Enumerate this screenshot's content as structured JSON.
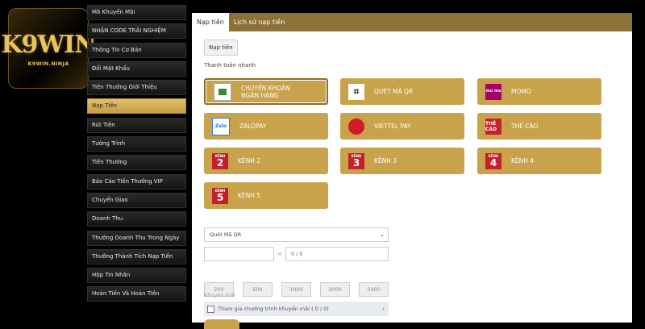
{
  "logo": {
    "main": "K9WIN",
    "sub": "K9WIN.NINJA"
  },
  "sidebar": {
    "items": [
      {
        "label": "Mã Khuyến Mãi"
      },
      {
        "label": "NHẬN CODE TRẢI NGHIỆM"
      },
      {
        "label": "Thông Tin Cơ Bản"
      },
      {
        "label": "Đổi Mật Khẩu"
      },
      {
        "label": "Tiền Thưởng Giới Thiệu"
      },
      {
        "label": "Nạp Tiền",
        "active": true
      },
      {
        "label": "Rút Tiền"
      },
      {
        "label": "Tường Trình"
      },
      {
        "label": "Tiền Thưởng"
      },
      {
        "label": "Báo Cáo Tiền Thưởng VIP"
      },
      {
        "label": "Chuyển Giao"
      },
      {
        "label": "Doanh Thu"
      },
      {
        "label": "Thưởng Doanh Thu Trong Ngày"
      },
      {
        "label": "Thưởng Thành Tích Nạp Tiền"
      },
      {
        "label": "Hộp Tin Nhắn"
      },
      {
        "label": "Hoàn Tiền Và Hoàn Tiền"
      }
    ]
  },
  "tabs": [
    {
      "label": "Nạp tiền",
      "active": true
    },
    {
      "label": "Lịch sử nạp tiền"
    }
  ],
  "top_button": "Nạp tiền",
  "section_label": "Thanh toán nhanh",
  "payment_methods": [
    {
      "line1": "CHUYỂN KHOẢN",
      "line2": "NGÂN HÀNG",
      "icon": "bank-transfer-icon",
      "selected": true
    },
    {
      "line1": "QUÉT MÃ QR",
      "line2": "",
      "icon": "qr-scan-icon",
      "icon_text": "⌗"
    },
    {
      "line1": "MOMO",
      "line2": "",
      "icon": "momo-icon",
      "icon_text": "mo mo"
    },
    {
      "line1": "ZALOPAY",
      "line2": "",
      "icon": "zalopay-icon",
      "icon_text": "Zalo"
    },
    {
      "line1": "VIETTEL PAY",
      "line2": "",
      "icon": "viettel-pay-icon",
      "icon_text": ""
    },
    {
      "line1": "THẺ CÀO",
      "line2": "",
      "icon": "scratch-card-icon",
      "icon_text": "THẺ CÀO"
    },
    {
      "line1": "KÊNH 2",
      "line2": "",
      "icon": "channel-icon",
      "icon_text": "KÊNH",
      "icon_num": "2"
    },
    {
      "line1": "KÊNH 3",
      "line2": "",
      "icon": "channel-icon",
      "icon_text": "KÊNH",
      "icon_num": "3"
    },
    {
      "line1": "KÊNH 4",
      "line2": "",
      "icon": "channel-icon",
      "icon_text": "KÊNH",
      "icon_num": "4"
    },
    {
      "line1": "KÊNH 5",
      "line2": "",
      "icon": "channel-icon",
      "icon_text": "KÊNH",
      "icon_num": "5"
    }
  ],
  "form": {
    "method_select": "Quét Mã QR",
    "amount_value": "",
    "separator": "=",
    "amount_result": "0 / 0",
    "quick_amounts": [
      "200",
      "500",
      "1000",
      "2000",
      "5000"
    ],
    "promo_label": "Khuyến mãi",
    "promo_text": "Tham gia chương trình khuyến mãi ( 0 / 0)"
  },
  "colors": {
    "gold": "#c9a24c",
    "tab_bar": "#8d7238",
    "active_menu": "#d4ae56"
  }
}
